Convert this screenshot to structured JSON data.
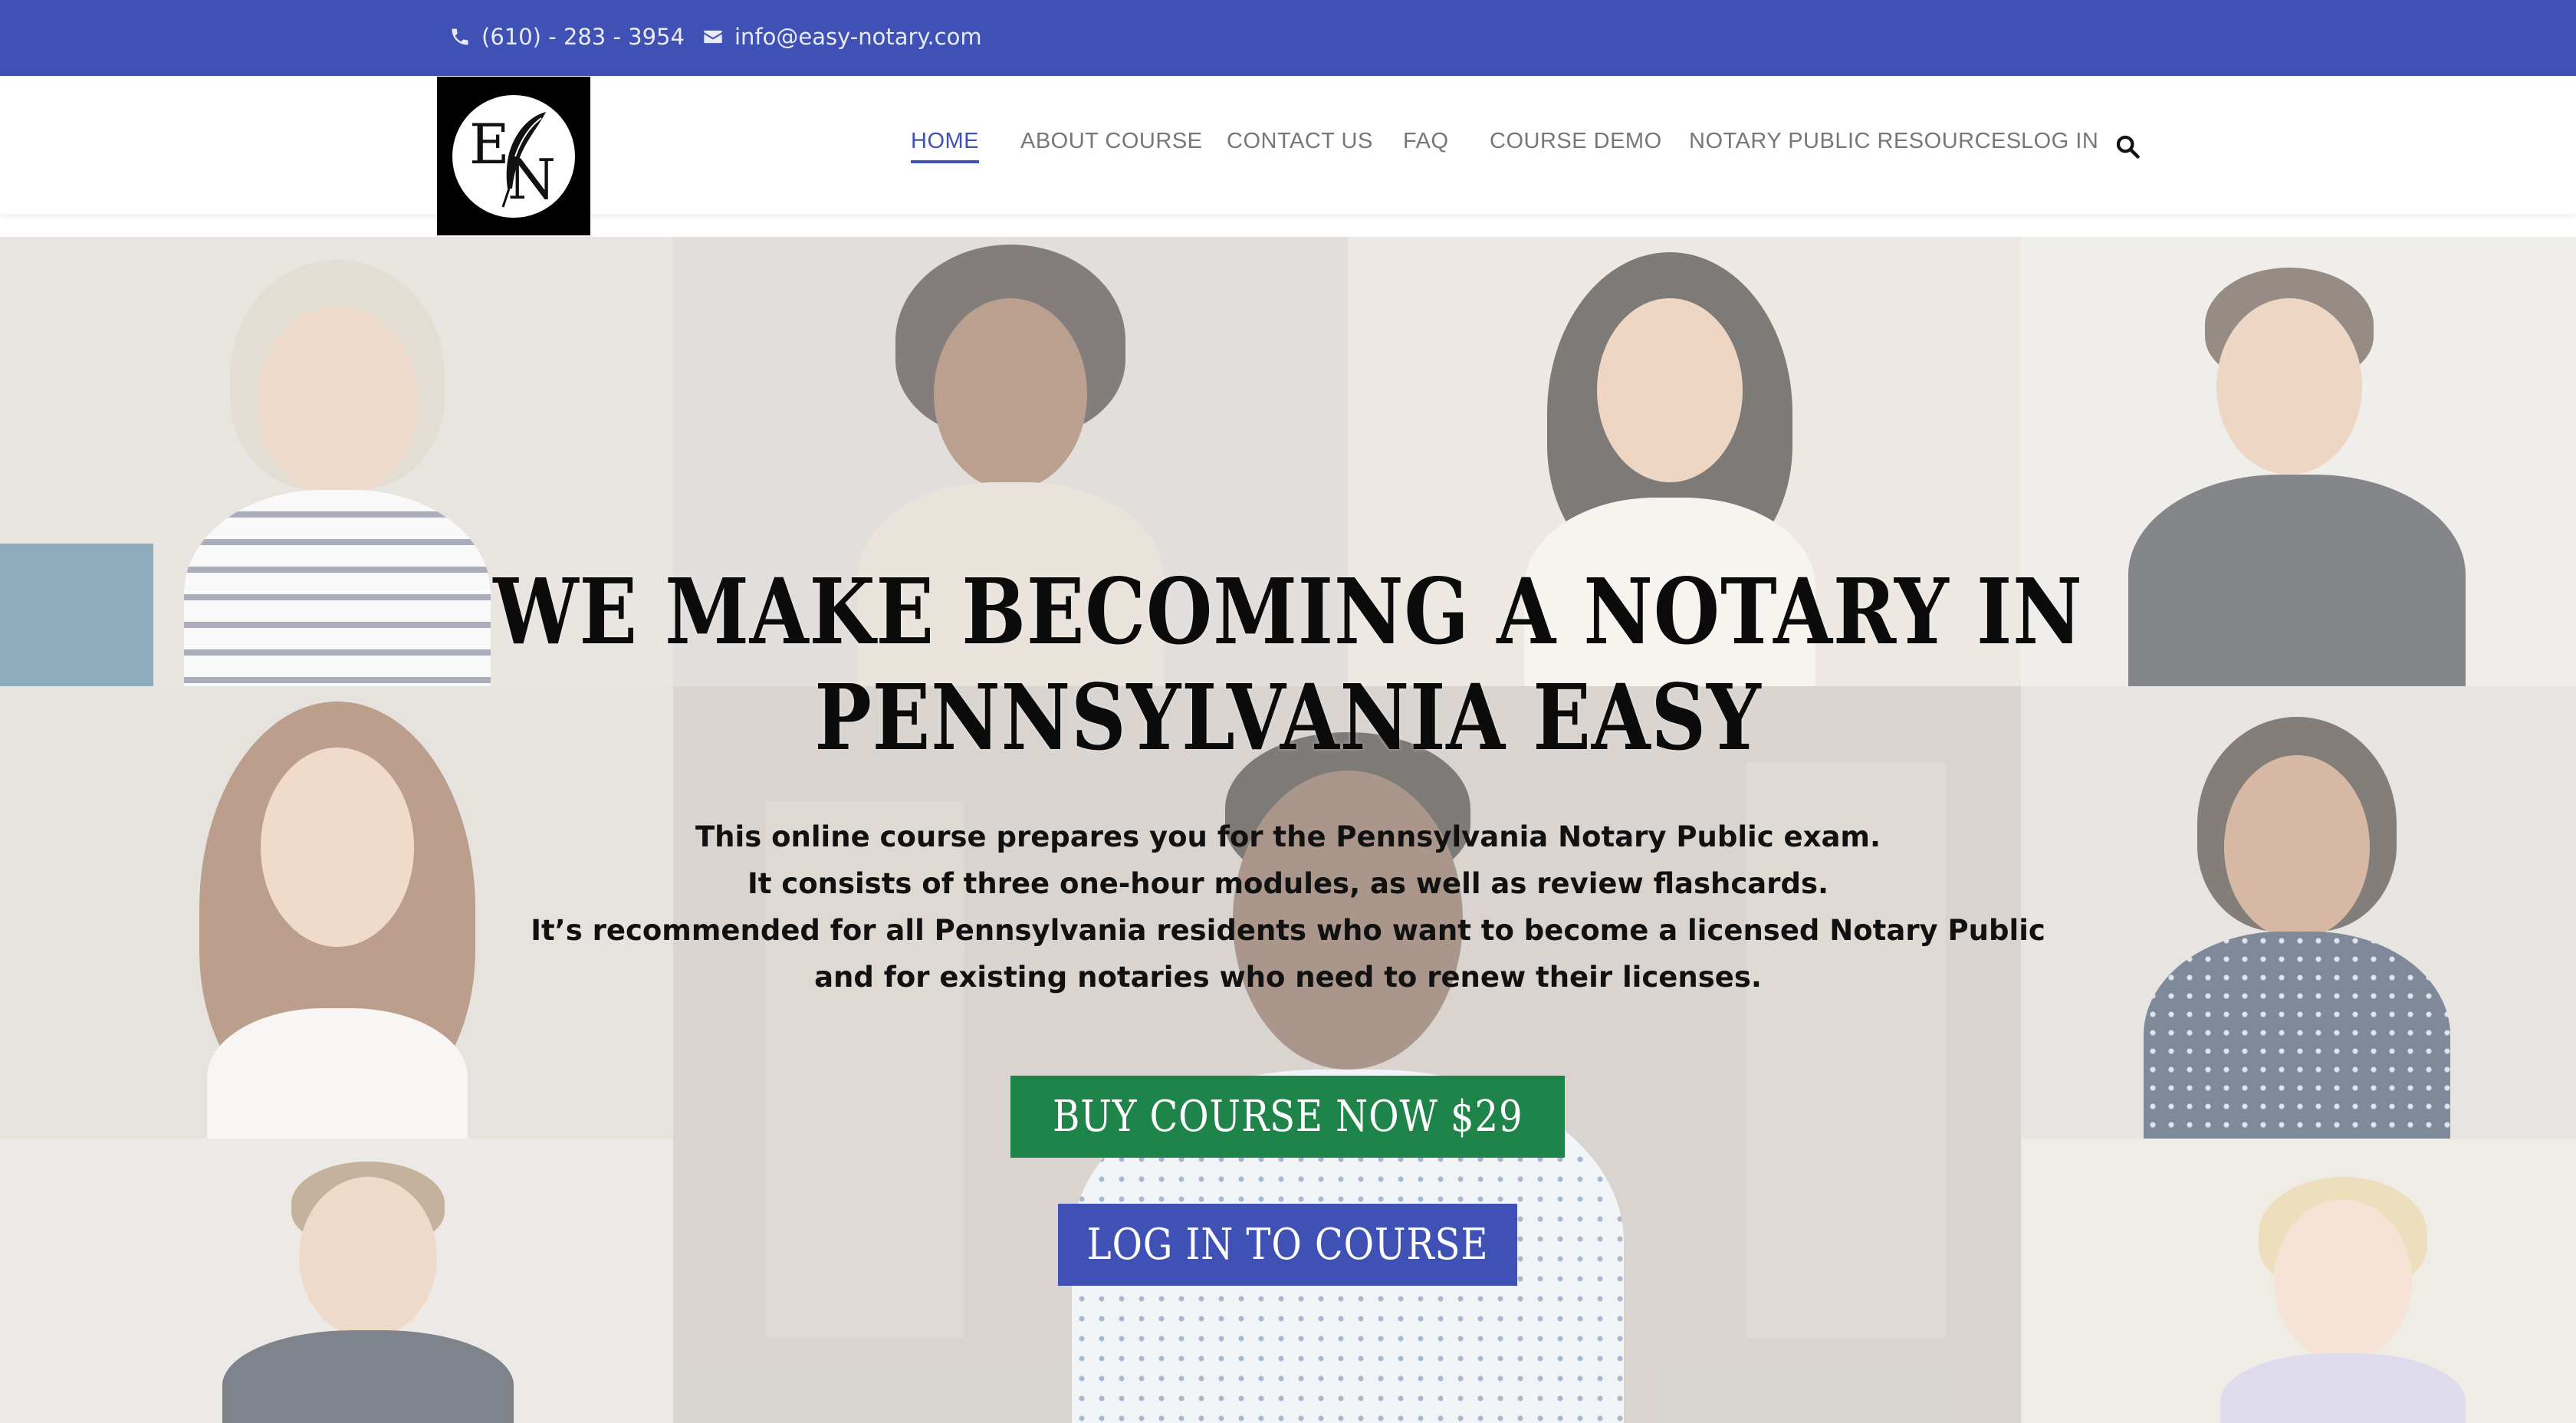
{
  "topbar": {
    "phone": "(610) - 283 - 3954",
    "email": "info@easy-notary.com"
  },
  "logo": {
    "letters": [
      "E",
      "N"
    ]
  },
  "nav": {
    "items": [
      {
        "label": "HOME",
        "active": true
      },
      {
        "label": "ABOUT COURSE",
        "active": false
      },
      {
        "label": "CONTACT US",
        "active": false
      },
      {
        "label": "FAQ",
        "active": false
      },
      {
        "label": "COURSE DEMO",
        "active": false
      },
      {
        "label": "NOTARY PUBLIC RESOURCES",
        "active": false
      },
      {
        "label": "LOG IN",
        "active": false
      }
    ],
    "search_icon": "search-icon"
  },
  "hero": {
    "headline": [
      "WE MAKE BECOMING A NOTARY IN",
      "PENNSYLVANIA EASY"
    ],
    "description": [
      "This online course prepares you for the Pennsylvania Notary Public exam.",
      "It consists of three one-hour modules, as well as review flashcards.",
      "It’s recommended for all Pennsylvania residents who want to become a licensed Notary Public",
      "and for existing notaries who need to renew their licenses."
    ],
    "buy_button": "BUY COURSE NOW $29",
    "login_button": "LOG IN TO COURSE"
  },
  "colors": {
    "brand": "#3f51b5",
    "buy": "#1e8449",
    "nav_text": "#777777"
  }
}
